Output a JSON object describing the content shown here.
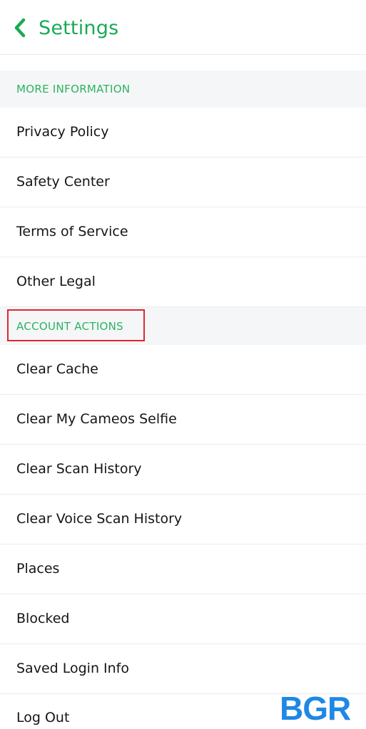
{
  "header": {
    "title": "Settings"
  },
  "sections": [
    {
      "label": "MORE INFORMATION",
      "items": [
        "Privacy Policy",
        "Safety Center",
        "Terms of Service",
        "Other Legal"
      ]
    },
    {
      "label": "ACCOUNT ACTIONS",
      "items": [
        "Clear Cache",
        "Clear My Cameos Selfie",
        "Clear Scan History",
        "Clear Voice Scan History",
        "Places",
        "Blocked",
        "Saved Login Info",
        "Log Out"
      ]
    }
  ],
  "watermark": "BGR",
  "colors": {
    "accent": "#1aaa55",
    "section_bg": "#f5f6f8",
    "highlight": "#e0262f",
    "watermark": "#1e88e5"
  },
  "icons": {
    "back": "chevron-left-icon"
  }
}
